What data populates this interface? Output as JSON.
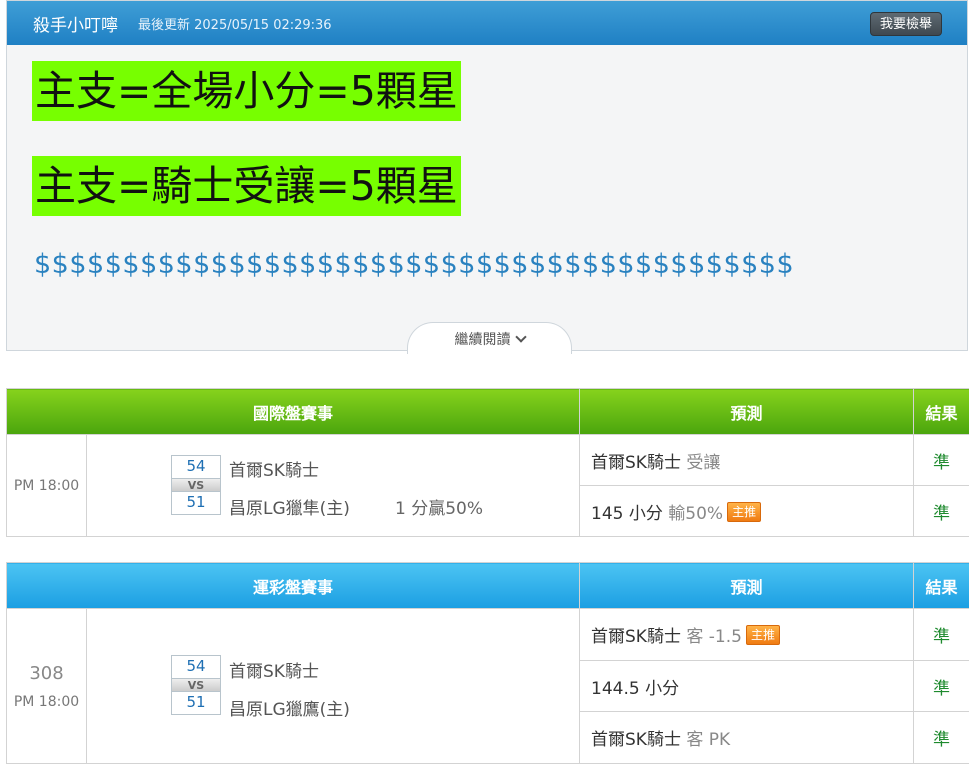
{
  "article": {
    "author": "殺手小叮嚀",
    "updated": "最後更新 2025/05/15 02:29:36",
    "report_label": "我要檢舉",
    "lines": [
      "主支=全場小分=5顆星",
      "主支=騎士受讓=5顆星"
    ],
    "dollars": "$$$$$$$$$$$$$$$$$$$$$$$$$$$$$$$$$$$$$$$$$$$",
    "more_label": "繼續閱讀",
    "colors": {
      "header": "#1f80c4",
      "highlight": "#77ff00",
      "dollars": "#2a82c0"
    }
  },
  "intl": {
    "headers": {
      "event": "國際盤賽事",
      "prediction": "預測",
      "result": "結果"
    },
    "time": "PM 18:00",
    "away": {
      "score": "54",
      "name": "首爾SK騎士"
    },
    "vs": "VS",
    "home": {
      "score": "51",
      "name": "昌原LG獵隼(主)"
    },
    "note": "1 分贏50%",
    "predictions": [
      {
        "pick": "首爾SK騎士",
        "detail": "受讓",
        "badge": "",
        "result": "準"
      },
      {
        "pick": "145 小分",
        "detail": "輸50%",
        "badge": "主推",
        "result": "準"
      }
    ]
  },
  "sports": {
    "headers": {
      "event": "運彩盤賽事",
      "prediction": "預測",
      "result": "結果"
    },
    "code": "308",
    "time": "PM 18:00",
    "away": {
      "score": "54",
      "name": "首爾SK騎士"
    },
    "vs": "VS",
    "home": {
      "score": "51",
      "name": "昌原LG獵鷹(主)"
    },
    "predictions": [
      {
        "pick": "首爾SK騎士",
        "detail": "客 -1.5",
        "badge": "主推",
        "result": "準"
      },
      {
        "pick": "144.5 小分",
        "detail": "",
        "badge": "",
        "result": "準"
      },
      {
        "pick": "首爾SK騎士",
        "detail": "客 PK",
        "badge": "",
        "result": "準"
      }
    ]
  }
}
